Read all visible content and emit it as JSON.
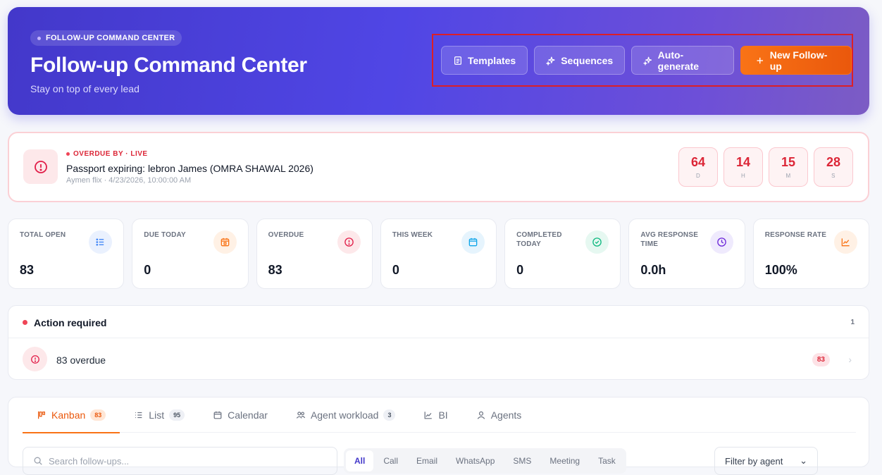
{
  "hero": {
    "pill": "FOLLOW-UP COMMAND CENTER",
    "title": "Follow-up Command Center",
    "subtitle": "Stay on top of every lead",
    "actions": {
      "templates": "Templates",
      "sequences": "Sequences",
      "auto_generate": "Auto-generate",
      "new_followup": "New Follow-up"
    }
  },
  "overdue_banner": {
    "tag": "OVERDUE BY · LIVE",
    "title": "Passport expiring: lebron James (OMRA SHAWAL 2026)",
    "meta": "Aymen flix · 4/23/2026, 10:00:00 AM",
    "timer": [
      {
        "value": "64",
        "unit": "D"
      },
      {
        "value": "14",
        "unit": "H"
      },
      {
        "value": "15",
        "unit": "M"
      },
      {
        "value": "28",
        "unit": "S"
      }
    ]
  },
  "stats": [
    {
      "label": "TOTAL OPEN",
      "value": "83",
      "icon": "list-icon",
      "color": "#3b82f6",
      "bg": "#eaf1fe"
    },
    {
      "label": "DUE TODAY",
      "value": "0",
      "icon": "calendar-icon",
      "color": "#f97316",
      "bg": "#fff1e5"
    },
    {
      "label": "OVERDUE",
      "value": "83",
      "icon": "alert-circle-icon",
      "color": "#e11d48",
      "bg": "#fde8ea"
    },
    {
      "label": "THIS WEEK",
      "value": "0",
      "icon": "calendar-icon",
      "color": "#0ea5e9",
      "bg": "#e6f4fd"
    },
    {
      "label": "COMPLETED TODAY",
      "value": "0",
      "icon": "check-circle-icon",
      "color": "#10b981",
      "bg": "#e6f8f1"
    },
    {
      "label": "AVG RESPONSE TIME",
      "value": "0.0h",
      "icon": "clock-icon",
      "color": "#6d28d9",
      "bg": "#efeafd"
    },
    {
      "label": "RESPONSE RATE",
      "value": "100%",
      "icon": "chart-icon",
      "color": "#f97316",
      "bg": "#fff1e5"
    }
  ],
  "action_required": {
    "title": "Action required",
    "count": "1",
    "row_label": "83 overdue",
    "row_badge": "83"
  },
  "tabs": [
    {
      "label": "Kanban",
      "count": "83",
      "icon": "kanban-icon",
      "active": true
    },
    {
      "label": "List",
      "count": "95",
      "icon": "list-icon",
      "active": false
    },
    {
      "label": "Calendar",
      "count": "",
      "icon": "calendar-icon",
      "active": false
    },
    {
      "label": "Agent workload",
      "count": "3",
      "icon": "users-icon",
      "active": false
    },
    {
      "label": "BI",
      "count": "",
      "icon": "chart-icon",
      "active": false
    },
    {
      "label": "Agents",
      "count": "",
      "icon": "user-icon",
      "active": false
    }
  ],
  "search": {
    "placeholder": "Search follow-ups..."
  },
  "filters": [
    "All",
    "Call",
    "Email",
    "WhatsApp",
    "SMS",
    "Meeting",
    "Task"
  ],
  "agent_filter": {
    "label": "Filter by agent"
  }
}
